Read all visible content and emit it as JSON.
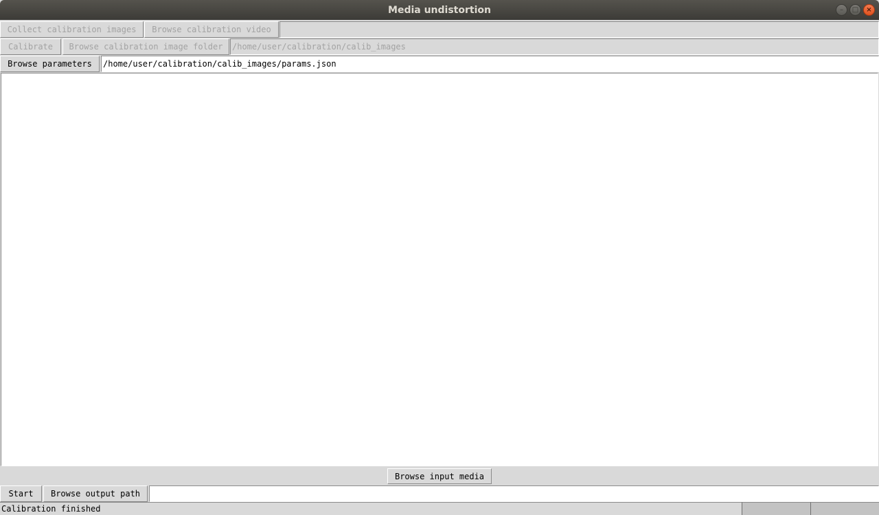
{
  "window": {
    "title": "Media undistortion",
    "controls": {
      "minimize_icon": "–",
      "maximize_icon": "□",
      "close_icon": "×"
    }
  },
  "row1": {
    "collect_label": "Collect calibration images",
    "browse_video_label": "Browse calibration video",
    "video_path": ""
  },
  "row2": {
    "calibrate_label": "Calibrate",
    "browse_folder_label": "Browse calibration image folder",
    "folder_path": "/home/user/calibration/calib_images"
  },
  "row3": {
    "browse_params_label": "Browse parameters",
    "params_path": "/home/user/calibration/calib_images/params.json"
  },
  "bottom": {
    "browse_input_label": "Browse input media",
    "start_label": "Start",
    "browse_output_label": "Browse output path",
    "output_path": ""
  },
  "status": {
    "text": "Calibration finished",
    "cell1": "",
    "cell2": ""
  }
}
